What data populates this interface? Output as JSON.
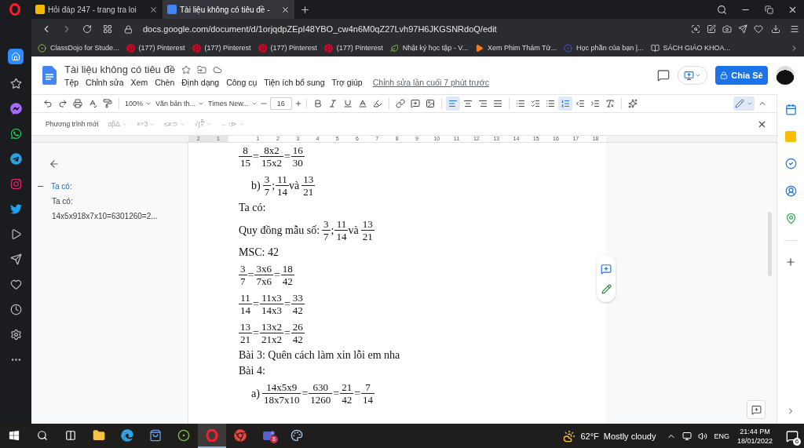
{
  "browser": {
    "tabs": [
      {
        "title": "Hỏi đáp 247 - trang tra loi",
        "selected": false
      },
      {
        "title": "Tài liệu không có tiêu đề -",
        "selected": true
      }
    ],
    "address": "docs.google.com/document/d/1orjqdpZEpI48YBO_cw4n6M0qZ27Lvh97H6JKGSNRdoQ/edit",
    "bookmarks": [
      {
        "text": "ClassDojo for Stude...",
        "kind": "dojo"
      },
      {
        "text": "(177) Pinterest",
        "kind": "pinterest"
      },
      {
        "text": "(177) Pinterest",
        "kind": "pinterest"
      },
      {
        "text": "(177) Pinterest",
        "kind": "pinterest"
      },
      {
        "text": "(177) Pinterest",
        "kind": "pinterest"
      },
      {
        "text": "Nhật ký học tập - V...",
        "kind": "leaf"
      },
      {
        "text": "Xem Phim Thám Tử...",
        "kind": "play"
      },
      {
        "text": "Học phần của bạn |...",
        "kind": "quiz"
      },
      {
        "text": "SÁCH GIÁO KHOA...",
        "kind": "book"
      }
    ]
  },
  "docs": {
    "title": "Tài liệu không có tiêu đề",
    "menu": [
      "Tệp",
      "Chỉnh sửa",
      "Xem",
      "Chèn",
      "Định dạng",
      "Công cụ",
      "Tiện ích bổ sung",
      "Trợ giúp"
    ],
    "last_edit": "Chỉnh sửa lần cuối 7 phút trước",
    "share": "Chia Sẻ"
  },
  "toolbar": [
    {
      "kind": "undo",
      "selected": false
    },
    {
      "kind": "redo",
      "selected": false
    },
    {
      "kind": "print",
      "selected": false
    },
    {
      "kind": "spell",
      "selected": false
    },
    {
      "kind": "paint",
      "selected": false
    },
    {
      "kind": "dropdown",
      "text": "100%",
      "selected": false
    },
    {
      "kind": "dropdown",
      "text": "Văn bản th...",
      "selected": false
    },
    {
      "kind": "dropdown",
      "text": "Times New...",
      "selected": false
    },
    {
      "kind": "size",
      "text": "16",
      "selected": false
    },
    {
      "kind": "bold",
      "selected": false
    },
    {
      "kind": "italic",
      "selected": false
    },
    {
      "kind": "underline",
      "selected": false
    },
    {
      "kind": "color",
      "selected": false
    },
    {
      "kind": "highlight",
      "selected": false
    },
    {
      "kind": "link",
      "selected": false
    },
    {
      "kind": "comment",
      "selected": false
    },
    {
      "kind": "image",
      "selected": false
    },
    {
      "kind": "align-left",
      "selected": true
    },
    {
      "kind": "align-center",
      "selected": false
    },
    {
      "kind": "align-right",
      "selected": false
    },
    {
      "kind": "justify",
      "selected": false
    },
    {
      "kind": "spacing",
      "selected": false
    },
    {
      "kind": "checklist",
      "selected": false
    },
    {
      "kind": "bullets",
      "selected": false
    },
    {
      "kind": "numbered",
      "selected": true
    },
    {
      "kind": "outdent",
      "selected": false
    },
    {
      "kind": "indent",
      "selected": false
    },
    {
      "kind": "clear",
      "selected": false
    },
    {
      "kind": "equation",
      "selected": false
    }
  ],
  "equation_bar": {
    "label": "Phương trình mới",
    "groups": [
      "αβΔ",
      "×÷3",
      "≤≠⊃",
      "√∫∛",
      "←↑⊳"
    ]
  },
  "ruler": {
    "before": [
      "2",
      "1"
    ],
    "after": [
      "1",
      "2",
      "3",
      "4",
      "5",
      "6",
      "7",
      "8",
      "9",
      "10",
      "11",
      "12",
      "13",
      "14",
      "15",
      "16",
      "17",
      "18"
    ]
  },
  "outline": [
    {
      "text": "Ta có:",
      "selected": true
    },
    {
      "text": "Ta có:",
      "selected": false
    },
    {
      "text": "14x5x918x7x10=6301260=2...",
      "selected": false
    }
  ],
  "document": [
    {
      "kind": "math",
      "indent": false,
      "items": [
        {
          "kind": "frac",
          "num": "8",
          "den": "15"
        },
        {
          "kind": "op",
          "text": "="
        },
        {
          "kind": "frac",
          "num": "8x2",
          "den": "15x2"
        },
        {
          "kind": "op",
          "text": "="
        },
        {
          "kind": "frac",
          "num": "16",
          "den": "30"
        }
      ]
    },
    {
      "kind": "math",
      "indent": true,
      "items": [
        {
          "kind": "text",
          "text": "b)"
        },
        {
          "kind": "frac",
          "num": "3",
          "den": "7"
        },
        {
          "kind": "op",
          "text": ";"
        },
        {
          "kind": "frac",
          "num": "11",
          "den": "14"
        },
        {
          "kind": "text",
          "text": "và"
        },
        {
          "kind": "frac",
          "num": "13",
          "den": "21"
        }
      ]
    },
    {
      "kind": "text",
      "indent": false,
      "text": "Ta có:"
    },
    {
      "kind": "math",
      "indent": false,
      "items": [
        {
          "kind": "text",
          "text": "Quy đồng mẫu số:"
        },
        {
          "kind": "frac",
          "num": "3",
          "den": "7"
        },
        {
          "kind": "op",
          "text": ";"
        },
        {
          "kind": "frac",
          "num": "11",
          "den": "14"
        },
        {
          "kind": "text",
          "text": "và"
        },
        {
          "kind": "frac",
          "num": "13",
          "den": "21"
        }
      ]
    },
    {
      "kind": "text",
      "indent": false,
      "text": "MSC: 42"
    },
    {
      "kind": "math",
      "indent": false,
      "items": [
        {
          "kind": "frac",
          "num": "3",
          "den": "7"
        },
        {
          "kind": "op",
          "text": "="
        },
        {
          "kind": "frac",
          "num": "3x6",
          "den": "7x6"
        },
        {
          "kind": "op",
          "text": "="
        },
        {
          "kind": "frac",
          "num": "18",
          "den": "42"
        }
      ]
    },
    {
      "kind": "math",
      "indent": false,
      "items": [
        {
          "kind": "frac",
          "num": "11",
          "den": "14"
        },
        {
          "kind": "op",
          "text": "="
        },
        {
          "kind": "frac",
          "num": "11x3",
          "den": "14x3"
        },
        {
          "kind": "op",
          "text": "="
        },
        {
          "kind": "frac",
          "num": "33",
          "den": "42"
        }
      ]
    },
    {
      "kind": "math",
      "indent": false,
      "items": [
        {
          "kind": "frac",
          "num": "13",
          "den": "21"
        },
        {
          "kind": "op",
          "text": "="
        },
        {
          "kind": "frac",
          "num": "13x2",
          "den": "21x2"
        },
        {
          "kind": "op",
          "text": "="
        },
        {
          "kind": "frac",
          "num": "26",
          "den": "42"
        }
      ]
    },
    {
      "kind": "text",
      "indent": false,
      "text": "Bài 3: Quên cách làm xin lỗi em nha"
    },
    {
      "kind": "text",
      "indent": false,
      "text": "Bài 4:"
    },
    {
      "kind": "math",
      "indent": true,
      "items": [
        {
          "kind": "text",
          "text": "a)"
        },
        {
          "kind": "frac",
          "num": "14x5x9",
          "den": "18x7x10"
        },
        {
          "kind": "op",
          "text": "="
        },
        {
          "kind": "frac",
          "num": "630",
          "den": "1260"
        },
        {
          "kind": "op",
          "text": "="
        },
        {
          "kind": "frac",
          "num": "21",
          "den": "42"
        },
        {
          "kind": "op",
          "text": "="
        },
        {
          "kind": "frac",
          "num": "7",
          "den": "14"
        }
      ]
    }
  ],
  "taskbar": {
    "apps": [
      {
        "kind": "explorer",
        "selected": false
      },
      {
        "kind": "edge",
        "selected": false
      },
      {
        "kind": "store",
        "selected": false
      },
      {
        "kind": "circle",
        "selected": false
      },
      {
        "kind": "opera",
        "selected": true
      },
      {
        "kind": "chrome",
        "selected": false
      },
      {
        "kind": "teams",
        "selected": false,
        "badge": "8"
      },
      {
        "kind": "paint",
        "selected": false
      }
    ],
    "temperature": "62°F",
    "weather": "Mostly cloudy",
    "language": "ENG",
    "time": "21:44 PM",
    "date": "18/01/2022",
    "notifications": "6"
  }
}
